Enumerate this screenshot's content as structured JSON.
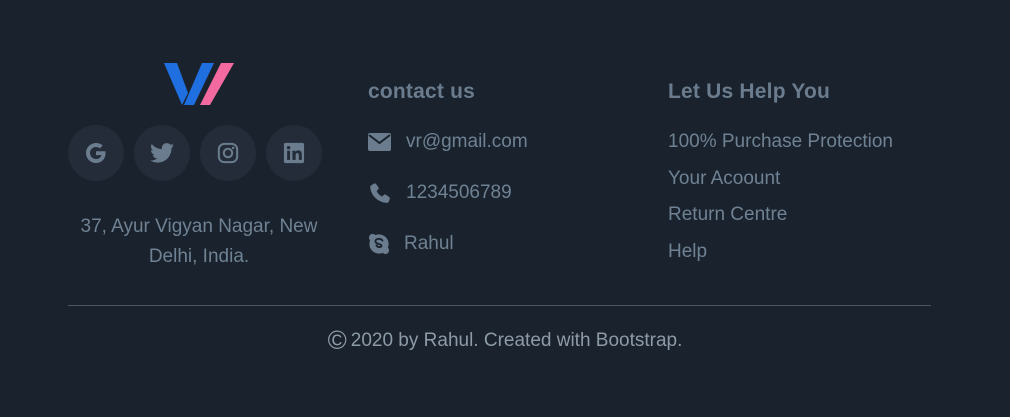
{
  "brand": {
    "logo_icon": "w-logo-icon",
    "colors": {
      "blue": "#1f6fe0",
      "pink": "#f26aa0"
    }
  },
  "social": [
    {
      "name": "google",
      "icon": "google-icon"
    },
    {
      "name": "twitter",
      "icon": "twitter-icon"
    },
    {
      "name": "instagram",
      "icon": "instagram-icon"
    },
    {
      "name": "linkedin",
      "icon": "linkedin-icon"
    }
  ],
  "address": "37, Ayur Vigyan Nagar, New Delhi, India.",
  "contact": {
    "title": "contact us",
    "email": "vr@gmail.com",
    "phone": "1234506789",
    "skype": "Rahul"
  },
  "help": {
    "title": "Let Us Help You",
    "links": [
      "100% Purchase Protection",
      "Your Acoount",
      "Return Centre",
      "Help"
    ]
  },
  "copyright": {
    "symbol": "©",
    "text": "2020 by Rahul. Created with Bootstrap."
  },
  "colors": {
    "background": "#1a222d",
    "text": "#6f8293",
    "icon": "#6a7c8d"
  }
}
